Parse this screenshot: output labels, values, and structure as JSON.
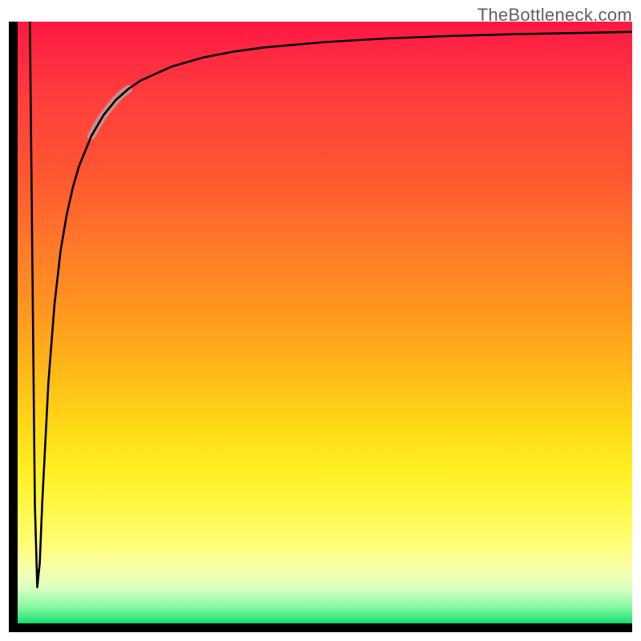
{
  "watermark": "TheBottleneck.com",
  "chart_data": {
    "type": "line",
    "title": "",
    "xlabel": "",
    "ylabel": "",
    "xlim": [
      0,
      100
    ],
    "ylim": [
      0,
      100
    ],
    "grid": false,
    "legend": false,
    "background_gradient": {
      "direction": "vertical",
      "stops": [
        {
          "pos": 0,
          "color": "#ff1744"
        },
        {
          "pos": 50,
          "color": "#ffcc18"
        },
        {
          "pos": 80,
          "color": "#ffff60"
        },
        {
          "pos": 100,
          "color": "#10c95e"
        }
      ]
    },
    "series": [
      {
        "name": "bottleneck-curve",
        "color": "#000000",
        "stroke_width": 2.5,
        "x": [
          2.0,
          2.4,
          2.8,
          3.2,
          3.6,
          4.0,
          5.0,
          6.0,
          7.0,
          8.0,
          9.0,
          10.0,
          12.0,
          14.0,
          16.0,
          18.0,
          20.0,
          25.0,
          30.0,
          35.0,
          40.0,
          50.0,
          60.0,
          70.0,
          80.0,
          90.0,
          100.0
        ],
        "y": [
          100.0,
          60.0,
          20.0,
          6.0,
          10.0,
          20.0,
          40.0,
          53.0,
          62.0,
          68.0,
          72.5,
          76.0,
          81.0,
          84.5,
          87.0,
          88.8,
          90.2,
          92.5,
          94.0,
          95.0,
          95.7,
          96.6,
          97.2,
          97.6,
          97.9,
          98.1,
          98.3
        ]
      },
      {
        "name": "highlight-segment",
        "color": "#c69090",
        "stroke_width": 10,
        "x": [
          12.0,
          13.0,
          14.0,
          15.0,
          16.0,
          17.0,
          18.0
        ],
        "y": [
          81.0,
          82.9,
          84.5,
          85.8,
          87.0,
          88.0,
          88.8
        ]
      }
    ],
    "note": "Axis tick labels are not shown in the source image; x and y are expressed in percent of the visible plot area."
  }
}
